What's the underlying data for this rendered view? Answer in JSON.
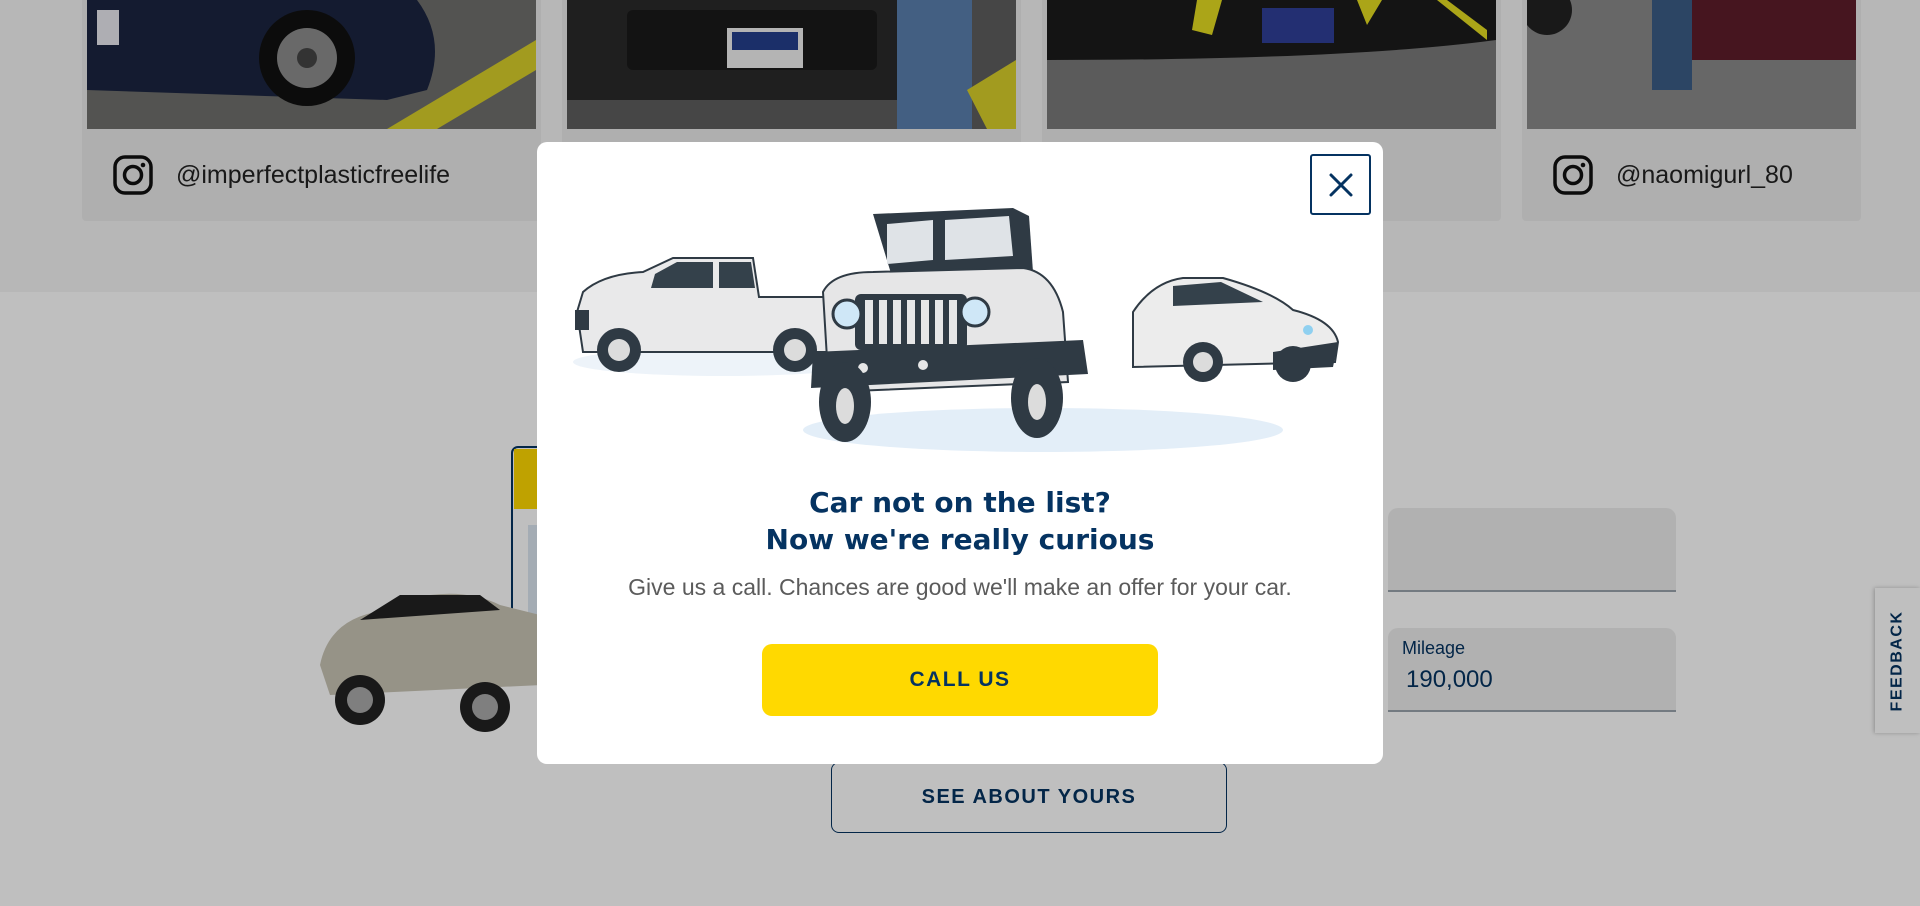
{
  "gallery": {
    "cards": [
      {
        "handle": "@imperfectplasticfreelife"
      },
      {
        "handle": ""
      },
      {
        "handle": ""
      },
      {
        "handle": "@naomigurl_80"
      }
    ]
  },
  "form": {
    "mileage_label": "Mileage",
    "mileage_value": "190,000",
    "submit_label": "SEE ABOUT YOURS"
  },
  "feedback": {
    "label": "FEEDBACK"
  },
  "modal": {
    "title_line1": "Car not on the list?",
    "title_line2": "Now we're really curious",
    "text": "Give us a call. Chances are good we'll make an offer for your car.",
    "cta_label": "CALL US",
    "close_icon": "close-icon"
  },
  "colors": {
    "brand_blue": "#053361",
    "brand_yellow": "#ffd900"
  }
}
